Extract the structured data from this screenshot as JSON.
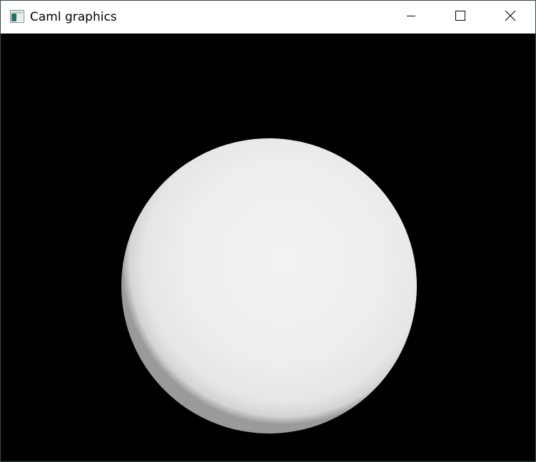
{
  "window": {
    "title": "Caml graphics"
  },
  "titlebar_buttons": {
    "minimize_icon": "minimize-icon",
    "maximize_icon": "maximize-icon",
    "close_icon": "close-icon"
  },
  "canvas": {
    "background": "#000000",
    "shape": "sphere",
    "sphere_color": "#f0f0f0",
    "sphere_edge_color": "#9a9a9a"
  }
}
